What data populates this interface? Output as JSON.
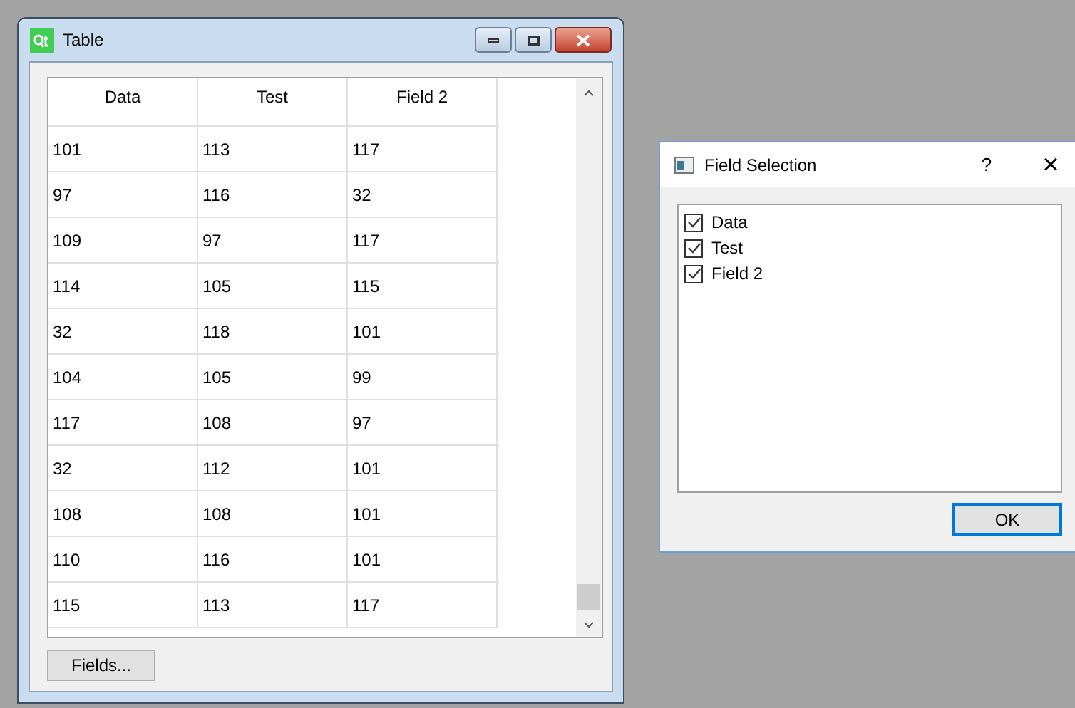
{
  "table_window": {
    "title": "Table",
    "columns": [
      "Data",
      "Test",
      "Field 2"
    ],
    "rows": [
      [
        "101",
        "113",
        "117"
      ],
      [
        "97",
        "116",
        "32"
      ],
      [
        "109",
        "97",
        "117"
      ],
      [
        "114",
        "105",
        "115"
      ],
      [
        "32",
        "118",
        "101"
      ],
      [
        "104",
        "105",
        "99"
      ],
      [
        "117",
        "108",
        "97"
      ],
      [
        "32",
        "112",
        "101"
      ],
      [
        "108",
        "108",
        "101"
      ],
      [
        "110",
        "116",
        "101"
      ],
      [
        "115",
        "113",
        "117"
      ]
    ],
    "button": "Fields..."
  },
  "dialog": {
    "title": "Field Selection",
    "help": "?",
    "close": "×",
    "fields": [
      {
        "label": "Data",
        "checked": true
      },
      {
        "label": "Test",
        "checked": true
      },
      {
        "label": "Field 2",
        "checked": true
      }
    ],
    "ok": "OK"
  }
}
